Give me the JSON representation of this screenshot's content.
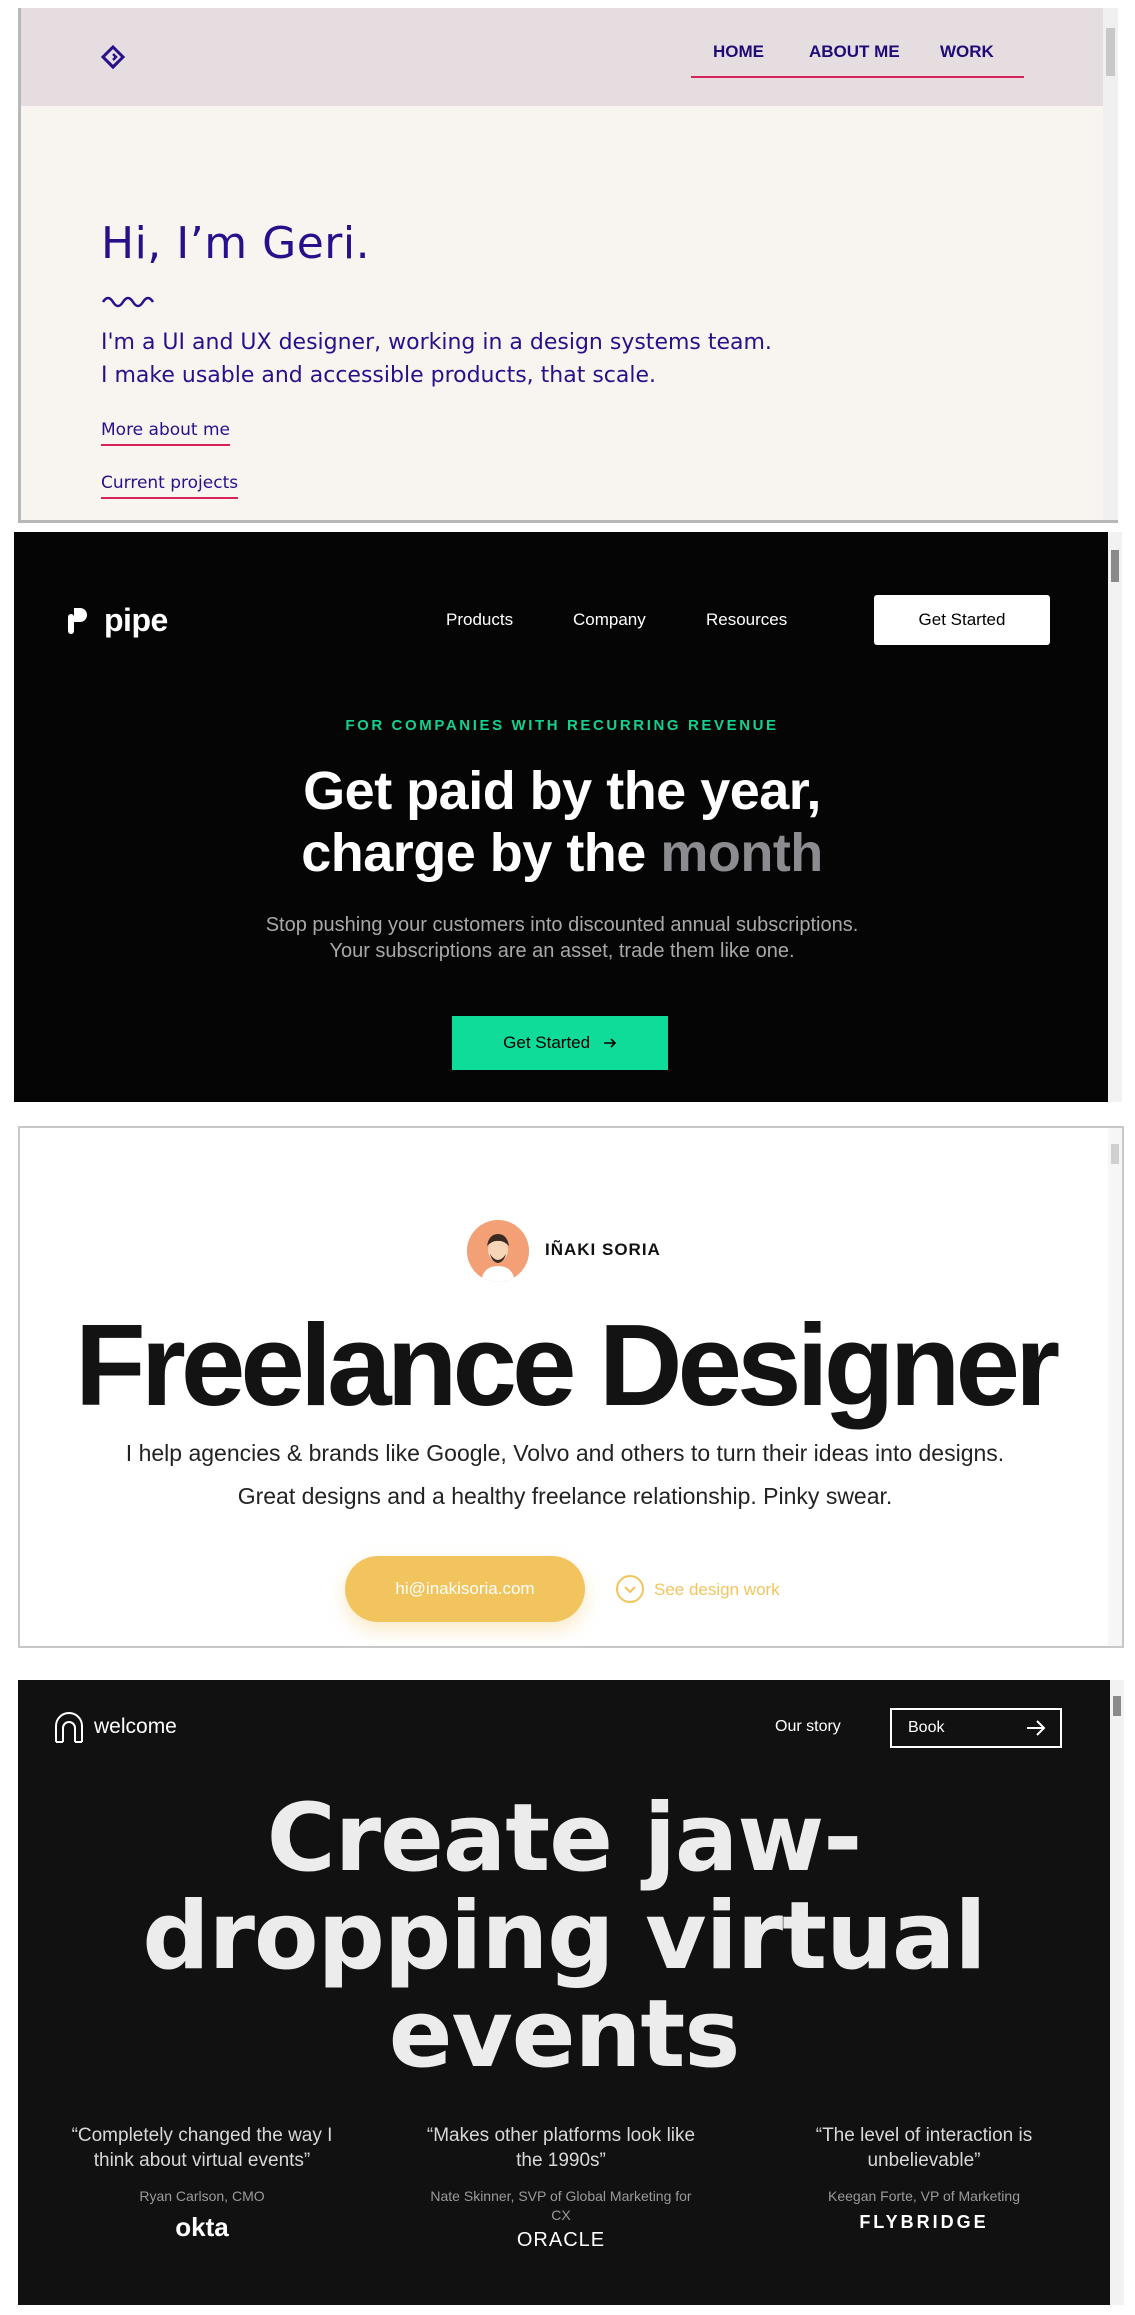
{
  "geri": {
    "nav": {
      "home": "HOME",
      "about": "ABOUT ME",
      "work": "WORK"
    },
    "title": "Hi, I’m Geri.",
    "intro_line1": "I'm a UI and UX designer, working in a design systems team.",
    "intro_line2": "I make usable and accessible products, that scale.",
    "link_about": "More about me",
    "link_projects": "Current projects",
    "colors": {
      "accent": "#d6245b",
      "text": "#2a0f8a",
      "nav_bg": "#e5dddf",
      "page_bg": "#f8f5f0"
    }
  },
  "pipe": {
    "logo": "pipe",
    "menu": {
      "products": "Products",
      "company": "Company",
      "resources": "Resources"
    },
    "cta_top": "Get Started",
    "eyebrow": "FOR COMPANIES WITH RECURRING REVENUE",
    "headline_line1": "Get paid by the year,",
    "headline_line2_a": "charge by the ",
    "headline_line2_accent": "month",
    "sub_line1": "Stop pushing your customers into discounted annual subscriptions.",
    "sub_line2": "Your subscriptions are an asset, trade them like one.",
    "cta": "Get Started",
    "colors": {
      "bg": "#050505",
      "green": "#0fdc98"
    }
  },
  "inaki": {
    "name": "IÑAKI SORIA",
    "headline": "Freelance Designer",
    "desc_line1": "I help agencies & brands like Google, Volvo and others to turn their ideas into designs.",
    "desc_line2": "Great designs and a healthy freelance relationship. Pinky swear.",
    "email": "hi@inakisoria.com",
    "work_link": "See design work",
    "colors": {
      "accent": "#f2c45e"
    }
  },
  "welcome": {
    "logo": "welcome",
    "nav_story": "Our story",
    "nav_book": "Book",
    "headline_line1": "Create jaw-",
    "headline_line2": "dropping virtual",
    "headline_line3": "events",
    "testimonials": [
      {
        "quote": "“Completely changed the way I think about virtual events”",
        "author": "Ryan Carlson, CMO",
        "brand": "okta"
      },
      {
        "quote": "“Makes other platforms look like the 1990s”",
        "author": "Nate Skinner, SVP of Global Marketing for CX",
        "brand": "ORACLE"
      },
      {
        "quote": "“The level of interaction is unbelievable”",
        "author": "Keegan Forte, VP of Marketing",
        "brand": "FLYBRIDGE"
      }
    ],
    "colors": {
      "bg": "#111111"
    }
  }
}
